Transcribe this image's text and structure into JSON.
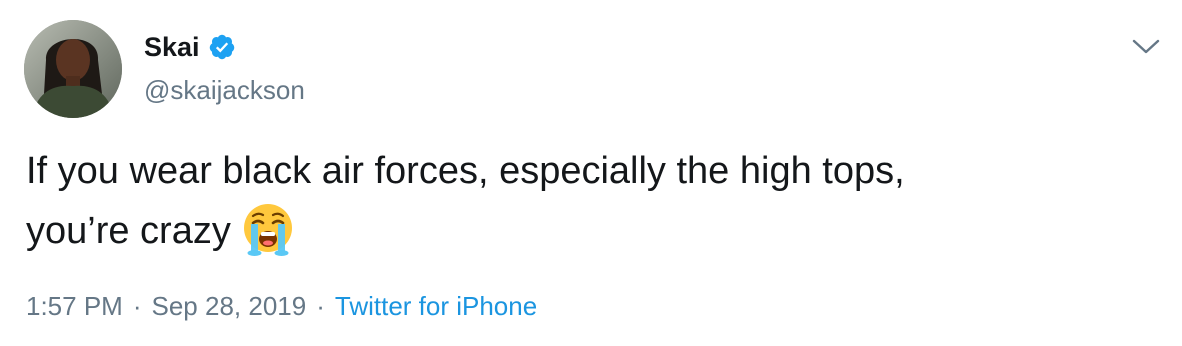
{
  "tweet": {
    "author": {
      "display_name": "Skai",
      "handle": "@skaijackson",
      "verified": true,
      "avatar_icon": "profile-photo"
    },
    "text_line1": "If you wear black air forces, especially the high tops,",
    "text_line2": "you’re crazy",
    "emoji_icon": "loudly-crying-face-icon",
    "time": "1:57 PM",
    "separator": "·",
    "date": "Sep 28, 2019",
    "source": "Twitter for iPhone",
    "menu_icon": "chevron-down-icon"
  },
  "colors": {
    "text": "#14171a",
    "secondary": "#657786",
    "link": "#1b95e0",
    "verified": "#1da1f2"
  }
}
